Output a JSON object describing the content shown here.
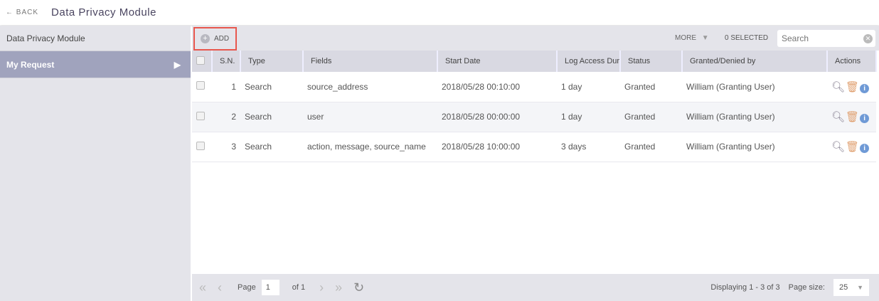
{
  "header": {
    "back_label": "BACK",
    "title": "Data Privacy Module"
  },
  "sidebar": {
    "items": [
      {
        "label": "Data Privacy Module"
      },
      {
        "label": "My Request",
        "active": true
      }
    ]
  },
  "toolbar": {
    "add_label": "ADD",
    "more_label": "MORE",
    "selected_label": "0 SELECTED",
    "search_placeholder": "Search"
  },
  "table": {
    "columns": [
      "S.N.",
      "Type",
      "Fields",
      "Start Date",
      "Log Access Dur",
      "Status",
      "Granted/Denied by",
      "Actions"
    ],
    "rows": [
      {
        "sn": "1",
        "type": "Search",
        "fields": "source_address",
        "start": "2018/05/28 00:10:00",
        "dur": "1 day",
        "status": "Granted",
        "by": "William (Granting User)"
      },
      {
        "sn": "2",
        "type": "Search",
        "fields": "user",
        "start": "2018/05/28 00:00:00",
        "dur": "1 day",
        "status": "Granted",
        "by": "William (Granting User)"
      },
      {
        "sn": "3",
        "type": "Search",
        "fields": "action, message, source_name",
        "start": "2018/05/28 10:00:00",
        "dur": "3 days",
        "status": "Granted",
        "by": "William (Granting User)"
      }
    ]
  },
  "footer": {
    "page_label": "Page",
    "page": "1",
    "of_label": "of 1",
    "displaying": "Displaying 1 - 3 of 3",
    "page_size_label": "Page size:",
    "page_size": "25"
  },
  "colors": {
    "accent": "#a0a3bd",
    "highlight": "#e8574e",
    "search_icon": "#8a8494",
    "trash_icon": "#e0a070",
    "info_icon": "#6f9ad6"
  }
}
